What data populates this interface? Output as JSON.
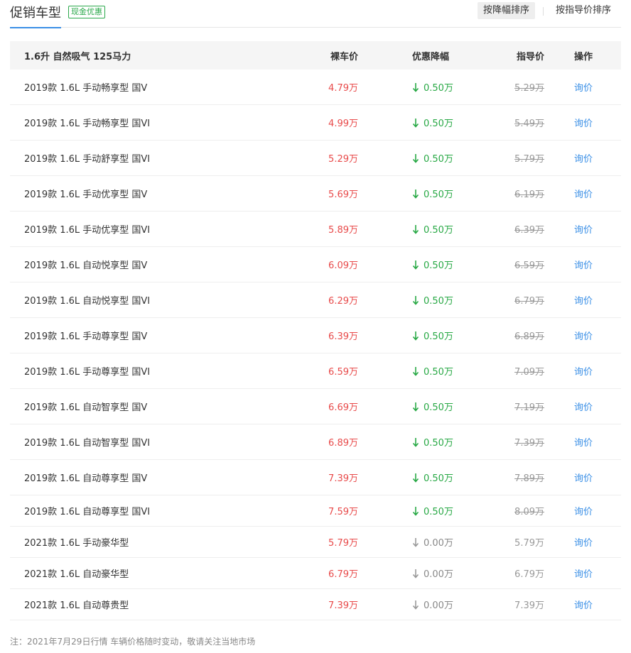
{
  "header": {
    "title": "促销车型",
    "badge": "现金优惠",
    "sort_discount": "按降幅排序",
    "sort_guide": "按指导价排序"
  },
  "table": {
    "group_title": "1.6升 自然吸气 125马力",
    "col_price": "裸车价",
    "col_discount": "优惠降幅",
    "col_guide": "指导价",
    "col_op": "操作",
    "rows": [
      {
        "name": "2019款 1.6L 手动畅享型 国V",
        "price": "4.79万",
        "discount": "0.50万",
        "guide": "5.29万",
        "op": "询价"
      },
      {
        "name": "2019款 1.6L 手动畅享型 国VI",
        "price": "4.99万",
        "discount": "0.50万",
        "guide": "5.49万",
        "op": "询价"
      },
      {
        "name": "2019款 1.6L 手动舒享型 国VI",
        "price": "5.29万",
        "discount": "0.50万",
        "guide": "5.79万",
        "op": "询价"
      },
      {
        "name": "2019款 1.6L 手动优享型 国V",
        "price": "5.69万",
        "discount": "0.50万",
        "guide": "6.19万",
        "op": "询价"
      },
      {
        "name": "2019款 1.6L 手动优享型 国VI",
        "price": "5.89万",
        "discount": "0.50万",
        "guide": "6.39万",
        "op": "询价"
      },
      {
        "name": "2019款 1.6L 自动悦享型 国V",
        "price": "6.09万",
        "discount": "0.50万",
        "guide": "6.59万",
        "op": "询价"
      },
      {
        "name": "2019款 1.6L 自动悦享型 国VI",
        "price": "6.29万",
        "discount": "0.50万",
        "guide": "6.79万",
        "op": "询价"
      },
      {
        "name": "2019款 1.6L 手动尊享型 国V",
        "price": "6.39万",
        "discount": "0.50万",
        "guide": "6.89万",
        "op": "询价"
      },
      {
        "name": "2019款 1.6L 手动尊享型 国VI",
        "price": "6.59万",
        "discount": "0.50万",
        "guide": "7.09万",
        "op": "询价"
      },
      {
        "name": "2019款 1.6L 自动智享型 国V",
        "price": "6.69万",
        "discount": "0.50万",
        "guide": "7.19万",
        "op": "询价"
      },
      {
        "name": "2019款 1.6L 自动智享型 国VI",
        "price": "6.89万",
        "discount": "0.50万",
        "guide": "7.39万",
        "op": "询价"
      },
      {
        "name": "2019款 1.6L 自动尊享型 国V",
        "price": "7.39万",
        "discount": "0.50万",
        "guide": "7.89万",
        "op": "询价"
      },
      {
        "name": "2019款 1.6L 自动尊享型 国VI",
        "price": "7.59万",
        "discount": "0.50万",
        "guide": "8.09万",
        "op": "询价"
      },
      {
        "name": "2021款 1.6L 手动豪华型",
        "price": "5.79万",
        "discount": "0.00万",
        "guide": "5.79万",
        "op": "询价"
      },
      {
        "name": "2021款 1.6L 自动豪华型",
        "price": "6.79万",
        "discount": "0.00万",
        "guide": "6.79万",
        "op": "询价"
      },
      {
        "name": "2021款 1.6L 自动尊贵型",
        "price": "7.39万",
        "discount": "0.00万",
        "guide": "7.39万",
        "op": "询价"
      }
    ]
  },
  "footer_note": "注：2021年7月29日行情 车辆价格随时变动，敬请关注当地市场",
  "colors": {
    "accent": "#3a8fe6",
    "price_red": "#e84a4a",
    "discount_green": "#27a844",
    "muted": "#999999"
  }
}
